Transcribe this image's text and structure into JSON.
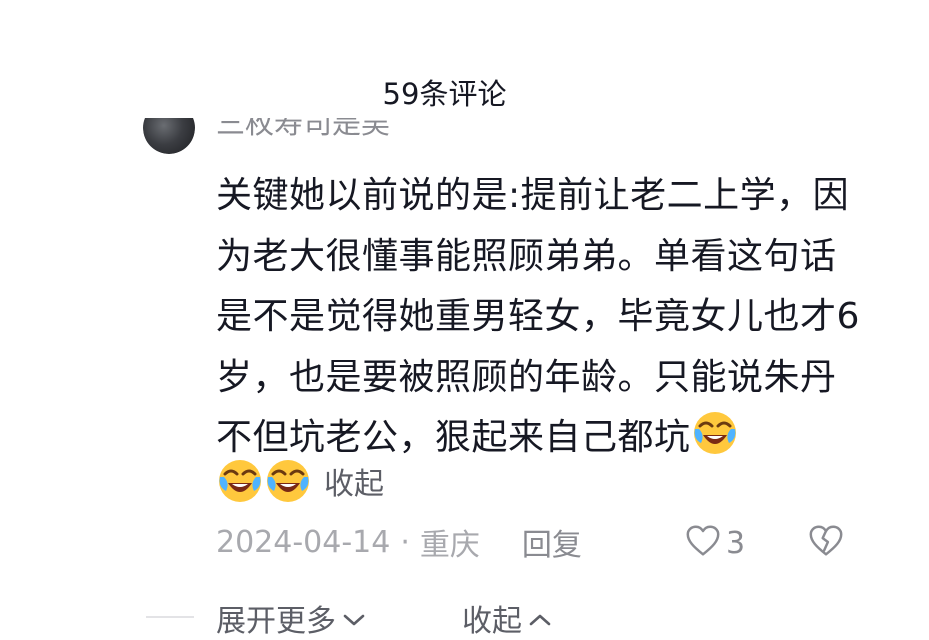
{
  "header": {
    "title": "59条评论"
  },
  "comment": {
    "username": "三枚寿司是吴",
    "text": "关键她以前说的是:提前让老二上学，因为老大很懂事能照顾弟弟。单看这句话是不是觉得她重男轻女，毕竟女儿也才6岁，也是要被照顾的年龄。只能说朱丹不但坑老公，狠起来自己都坑",
    "inline_emoji": "laughing-crying-emoji",
    "collapse_label": "收起",
    "date": "2024-04-14",
    "separator": "·",
    "location": "重庆",
    "reply_label": "回复",
    "like_count": "3"
  },
  "footer": {
    "expand_more_label": "展开更多",
    "collapse_label": "收起"
  },
  "colors": {
    "primary_text": "#161823",
    "secondary_text": "#8a8b91",
    "meta_text": "#a8a9ae",
    "divider": "#e3e3e6"
  }
}
